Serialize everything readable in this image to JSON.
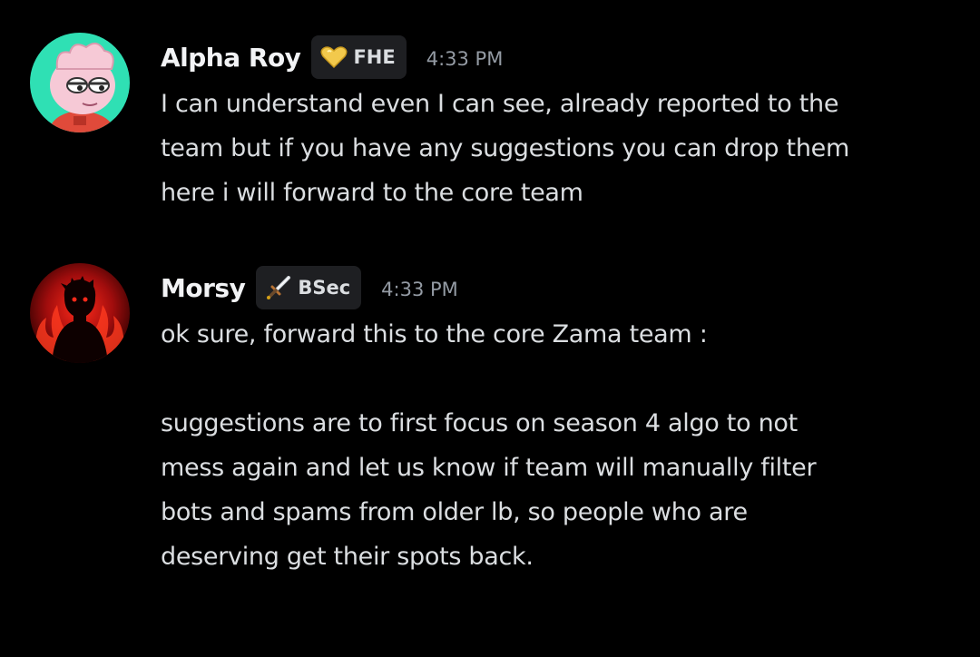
{
  "messages": [
    {
      "username": "Alpha Roy",
      "tag": "FHE",
      "tag_icon": "gold-heart-icon",
      "timestamp": "4:33 PM",
      "avatar": "cartoon-avatar-teal",
      "lines": [
        "I can understand even I can see, already reported to the",
        "team but if you have any suggestions you can drop them",
        "here i will forward to the core team"
      ]
    },
    {
      "username": "Morsy",
      "tag": "BSec",
      "tag_icon": "sword-icon",
      "timestamp": "4:33 PM",
      "avatar": "red-silhouette-avatar",
      "lines": [
        "ok sure, forward this to the core Zama team :",
        "",
        "suggestions are to first focus on season 4 algo to not",
        "mess again and let us know if team will manually filter",
        "bots and spams from older lb, so people who are",
        "deserving get their spots back."
      ]
    }
  ],
  "colors": {
    "background": "#000000",
    "username": "#f2f3f5",
    "text": "#dbdee1",
    "timestamp": "#949ba4",
    "tag_background": "#1e1f22"
  }
}
